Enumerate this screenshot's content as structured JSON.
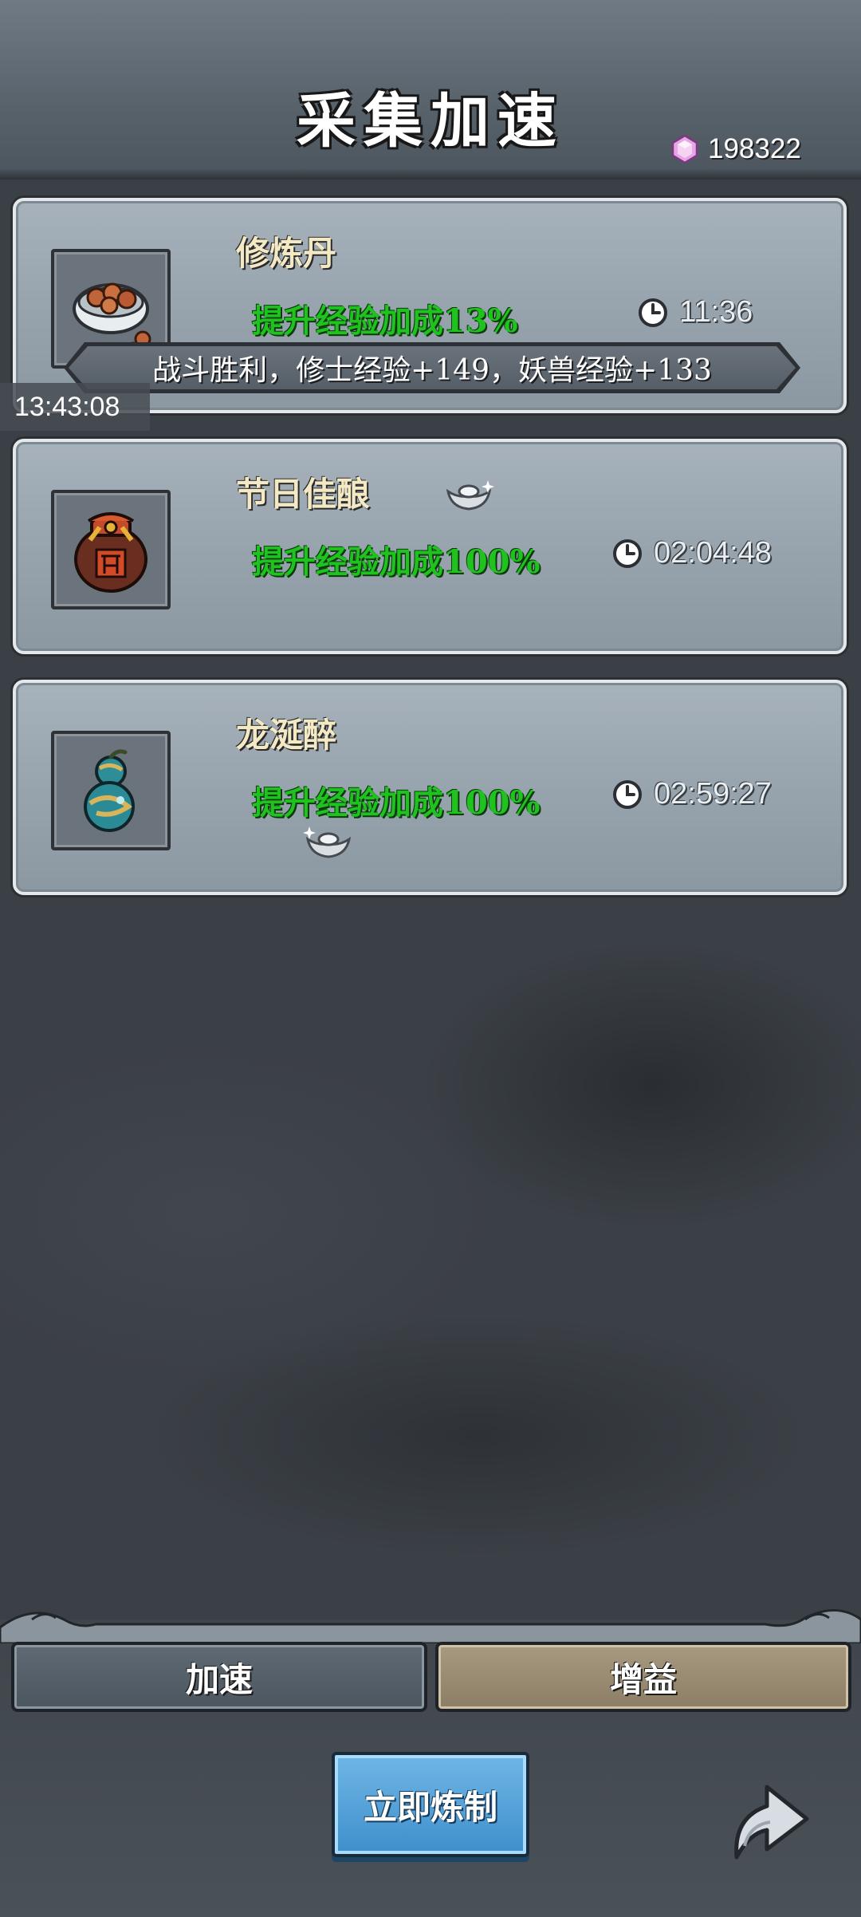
{
  "header": {
    "title": "采集加速",
    "currency_icon": "pink-gem-icon",
    "currency_value": "198322"
  },
  "cards": [
    {
      "name": "修炼丹",
      "icon": "pill-bowl-icon",
      "effect": "提升经验加成13%",
      "timer": "11:36"
    },
    {
      "name": "节日佳酿",
      "icon": "wine-jar-icon",
      "effect": "提升经验加成100%",
      "timer": "02:04:48"
    },
    {
      "name": "龙涎醉",
      "icon": "gourd-icon",
      "effect": "提升经验加成100%",
      "timer": "02:59:27"
    }
  ],
  "notice": {
    "text": "战斗胜利，修士经验+149，妖兽经验+133"
  },
  "overlay_clock": "13:43:08",
  "tabs": {
    "speed_label": "加速",
    "buff_label": "增益"
  },
  "actions": {
    "craft_label": "立即炼制",
    "back_icon": "return-arrow-icon"
  },
  "colors": {
    "effect_green": "#1fc21f",
    "craft_blue": "#3f8fcb",
    "active_tab": "#a89a80"
  }
}
